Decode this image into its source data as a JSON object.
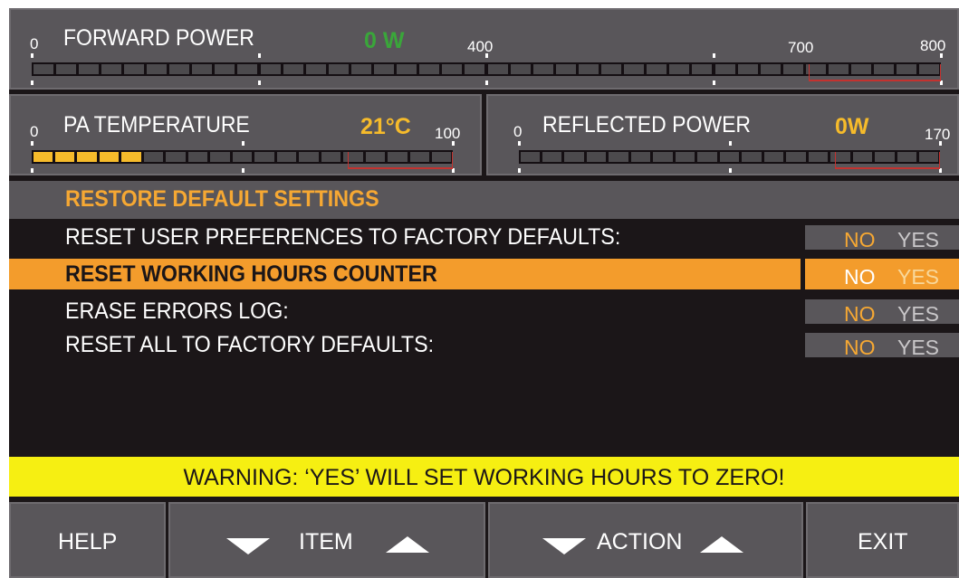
{
  "forward_power": {
    "label": "FORWARD POWER",
    "value": "0 W",
    "value_color": "#3aa63a",
    "scale": [
      "0",
      "400",
      "700",
      "800"
    ]
  },
  "pa_temperature": {
    "label": "PA TEMPERATURE",
    "value": "21°C",
    "value_color": "#f6bb2b",
    "scale_min": "0",
    "scale_max": "100",
    "level_fraction": 0.28
  },
  "reflected_power": {
    "label": "REFLECTED POWER",
    "value": "0W",
    "value_color": "#f6bb2b",
    "scale_min": "0",
    "scale_max": "170"
  },
  "section": {
    "title": "RESTORE DEFAULT SETTINGS"
  },
  "options": [
    {
      "label": "RESET USER PREFERENCES TO FACTORY DEFAULTS:",
      "no": "NO",
      "yes": "YES",
      "selected": false
    },
    {
      "label": "RESET WORKING HOURS COUNTER",
      "no": "NO",
      "yes": "YES",
      "selected": true
    },
    {
      "label": "ERASE ERRORS LOG:",
      "no": "NO",
      "yes": "YES",
      "selected": false
    },
    {
      "label": "RESET ALL TO FACTORY DEFAULTS:",
      "no": "NO",
      "yes": "YES",
      "selected": false
    }
  ],
  "warning": {
    "text": "WARNING: ‘YES’ WILL SET WORKING HOURS TO ZERO!"
  },
  "buttons": {
    "help": "HELP",
    "item": "ITEM",
    "action": "ACTION",
    "exit": "EXIT"
  },
  "colors": {
    "accent_orange": "#f39c2c",
    "warning_yellow": "#f6ef12",
    "panel_gray": "#59565a",
    "background": "#1b1618"
  }
}
